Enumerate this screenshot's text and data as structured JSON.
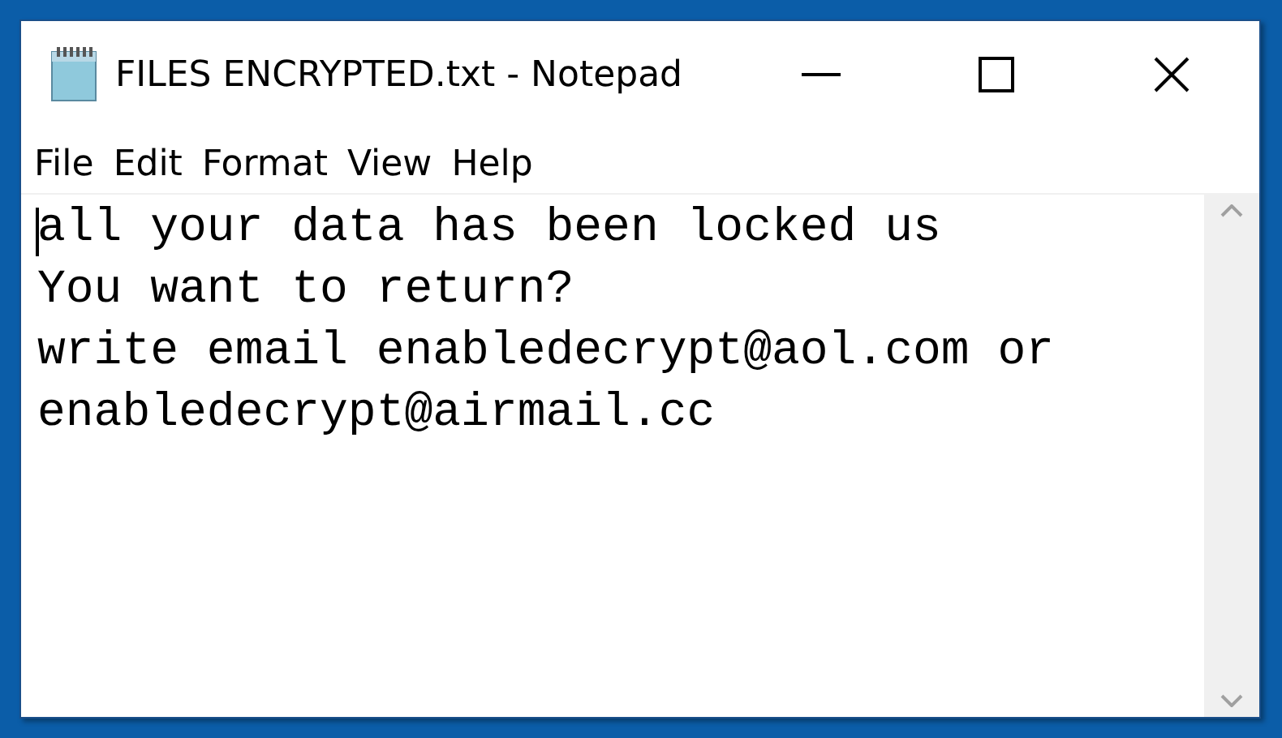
{
  "window": {
    "title": "FILES ENCRYPTED.txt - Notepad",
    "controls": [
      {
        "kind": "minimize"
      },
      {
        "kind": "maximize"
      },
      {
        "kind": "close"
      }
    ]
  },
  "menu": [
    "File",
    "Edit",
    "Format",
    "View",
    "Help"
  ],
  "document": {
    "lines": [
      "all your data has been locked us",
      "You want to return?",
      "write email enabledecrypt@aol.com or",
      "enabledecrypt@airmail.cc"
    ]
  }
}
